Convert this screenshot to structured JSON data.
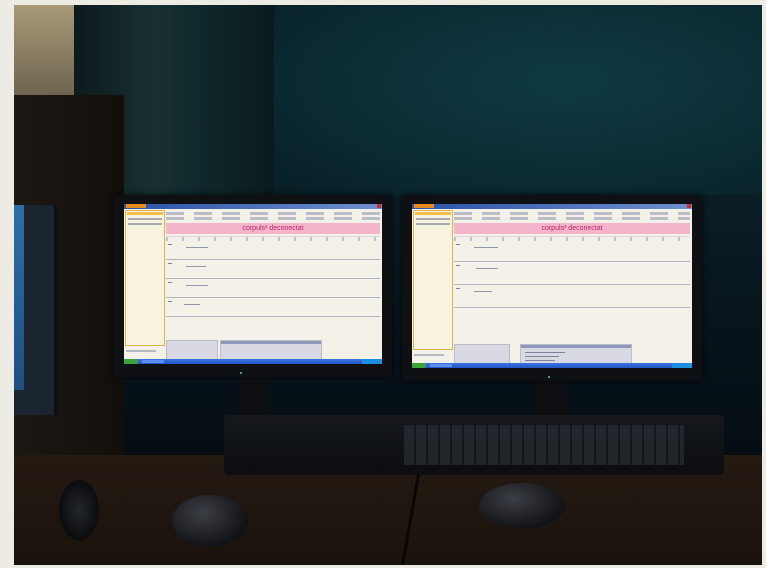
{
  "scene": {
    "description_colors": {
      "wall": "#0b2b33",
      "desk": "#1a120c",
      "screen_bg": "#f3f1e8",
      "banner_bg": "#f4b4cc",
      "banner_text": "#c0246a",
      "title_bar": "#2b53a6",
      "taskbar": "#2456c6"
    }
  },
  "monitors": [
    {
      "banner_text": "corpuls³ deconectat"
    },
    {
      "banner_text": "corpuls³ deconectat"
    }
  ]
}
